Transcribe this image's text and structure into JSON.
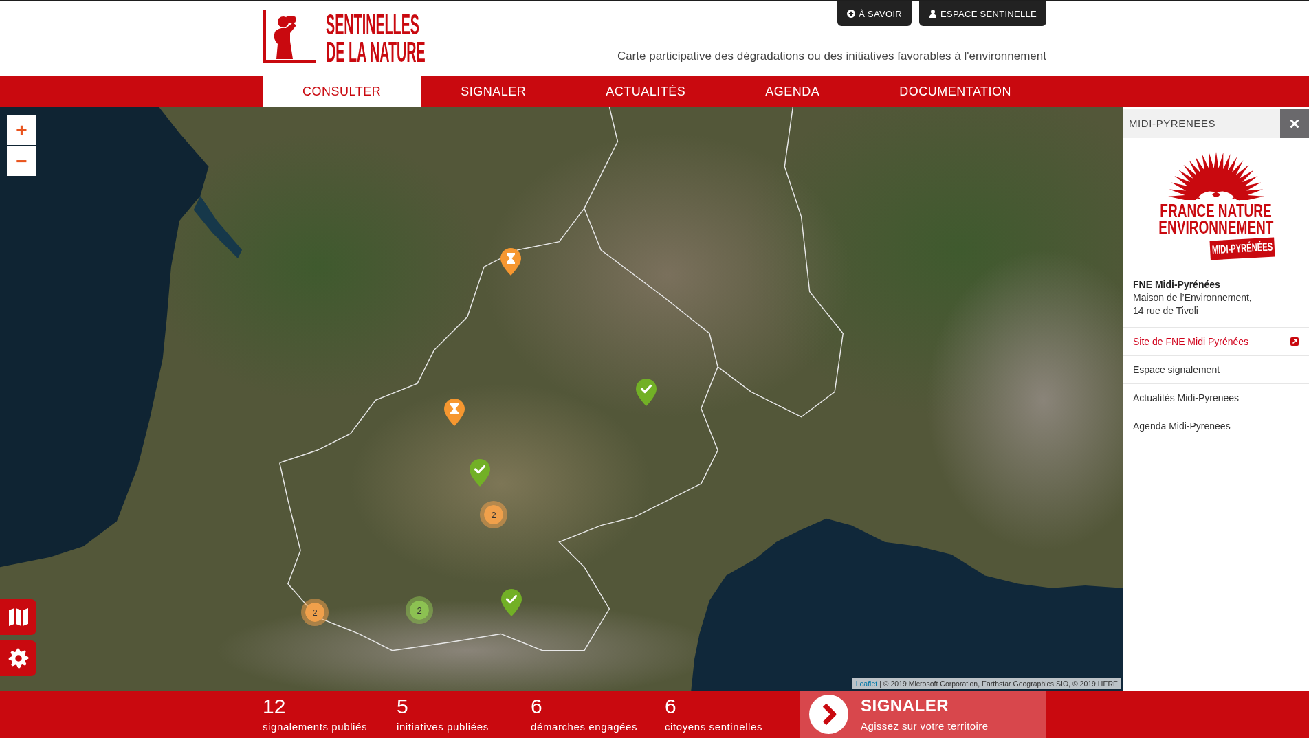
{
  "header": {
    "logo": {
      "line1": "SENTINELLES",
      "line2": "DE LA NATURE"
    },
    "buttons": [
      {
        "label": "À SAVOIR",
        "kind": "info"
      },
      {
        "label": "ESPACE SENTINELLE",
        "kind": "user"
      }
    ],
    "tagline": "Carte participative des dégradations ou des initiatives favorables à l'environnement"
  },
  "nav": [
    {
      "label": "CONSULTER",
      "selected": true
    },
    {
      "label": "SIGNALER",
      "selected": false
    },
    {
      "label": "ACTUALITÉS",
      "selected": false
    },
    {
      "label": "AGENDA",
      "selected": false
    },
    {
      "label": "DOCUMENTATION",
      "selected": false
    }
  ],
  "map": {
    "zoom_in": "+",
    "zoom_out": "−",
    "markers": [
      {
        "kind": "hourglass",
        "color": "#f69730"
      },
      {
        "kind": "check",
        "color": "#72b026"
      },
      {
        "kind": "hourglass",
        "color": "#f69730"
      },
      {
        "kind": "check",
        "color": "#72b026"
      },
      {
        "kind": "cluster",
        "color": "#f0a04b",
        "count": "2"
      },
      {
        "kind": "check",
        "color": "#72b026"
      },
      {
        "kind": "cluster",
        "color": "#8cc152",
        "count": "2"
      },
      {
        "kind": "cluster",
        "color": "#f0a04b",
        "count": "2"
      }
    ],
    "attribution": {
      "link": "Leaflet",
      "text": "| © 2019 Microsoft Corporation, Earthstar Geographics SIO, © 2019 HERE"
    }
  },
  "panel": {
    "title": "MIDI-PYRENEES",
    "logo": {
      "line1": "FRANCE NATURE",
      "line2": "ENVIRONNEMENT",
      "banner": "MIDI-PYRÉNÉES"
    },
    "org": {
      "name": "FNE Midi-Pyrénées",
      "address": [
        "Maison de l’Environnement,",
        "14 rue de Tivoli"
      ]
    },
    "links": [
      {
        "label": "Site de FNE Midi Pyrénées",
        "kind": "external"
      },
      {
        "label": "Espace signalement",
        "kind": "plain"
      },
      {
        "label": "Actualités Midi-Pyrenees",
        "kind": "plain"
      },
      {
        "label": "Agenda Midi-Pyrenees",
        "kind": "plain"
      }
    ]
  },
  "footer": {
    "stats": [
      {
        "value": "12",
        "label": "signalements publiés"
      },
      {
        "value": "5",
        "label": "initiatives publiées"
      },
      {
        "value": "6",
        "label": "démarches engagées"
      },
      {
        "value": "6",
        "label": "citoyens sentinelles"
      }
    ],
    "cta": {
      "title": "SIGNALER",
      "subtitle": "Agissez sur votre territoire"
    }
  }
}
